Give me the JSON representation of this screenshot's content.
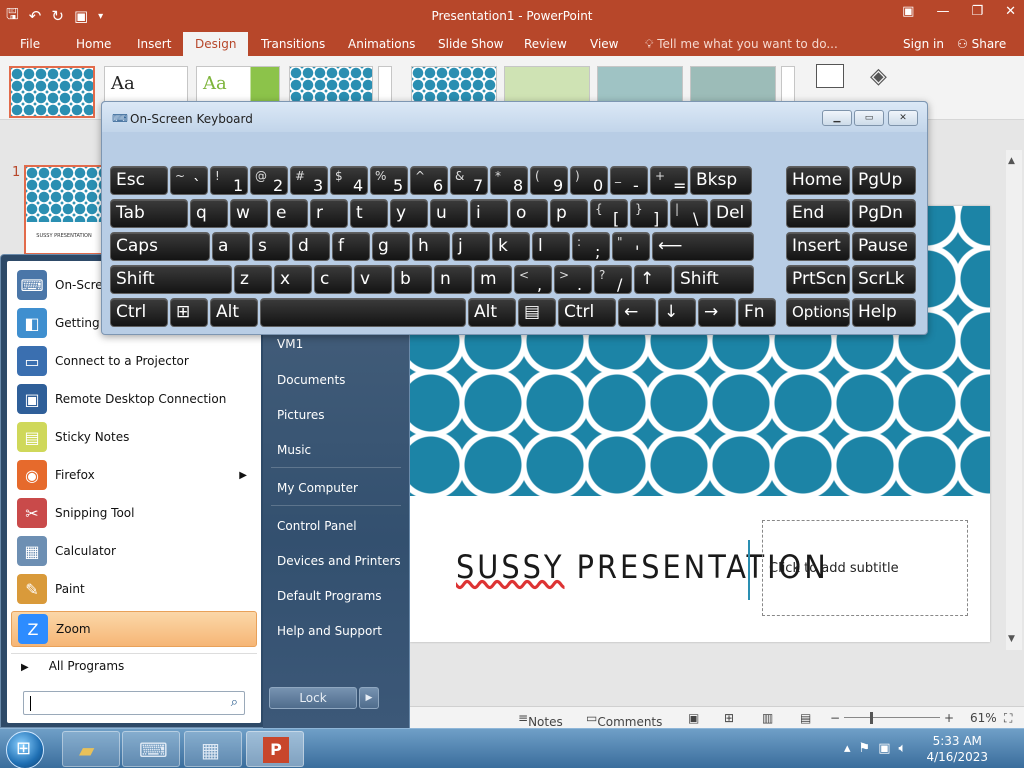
{
  "titlebar": {
    "title": "Presentation1 - PowerPoint",
    "qat_icons": [
      "save-icon",
      "undo-icon",
      "redo-icon",
      "present-icon",
      "customize-icon"
    ]
  },
  "tabs": [
    "File",
    "Home",
    "Insert",
    "Design",
    "Transitions",
    "Animations",
    "Slide Show",
    "Review",
    "View"
  ],
  "active_tab": "Design",
  "tell_me": "Tell me what you want to do...",
  "sign_in": "Sign in",
  "share": "Share",
  "ribbon": {
    "theme_aa": "Aa"
  },
  "thumbnail": {
    "number": "1",
    "caption": "SUSSY PRESENTATION"
  },
  "slide": {
    "title_part1": "SUSSY",
    "title_part2": " PRESENTATION",
    "subtitle_placeholder": "Click to add subtitle"
  },
  "statusbar": {
    "notes": "Notes",
    "comments": "Comments",
    "zoom": "61%",
    "minus": "−",
    "plus": "+"
  },
  "osk": {
    "title": "On-Screen Keyboard",
    "rows": [
      [
        {
          "l": "Esc",
          "w": 58
        },
        {
          "s": "~",
          "m": "`",
          "w": 38
        },
        {
          "s": "!",
          "m": "1",
          "w": 38
        },
        {
          "s": "@",
          "m": "2",
          "w": 38
        },
        {
          "s": "#",
          "m": "3",
          "w": 38
        },
        {
          "s": "$",
          "m": "4",
          "w": 38
        },
        {
          "s": "%",
          "m": "5",
          "w": 38
        },
        {
          "s": "^",
          "m": "6",
          "w": 38
        },
        {
          "s": "&",
          "m": "7",
          "w": 38
        },
        {
          "s": "*",
          "m": "8",
          "w": 38
        },
        {
          "s": "(",
          "m": "9",
          "w": 38
        },
        {
          "s": ")",
          "m": "0",
          "w": 38
        },
        {
          "s": "_",
          "m": "-",
          "w": 38
        },
        {
          "s": "+",
          "m": "=",
          "w": 38
        },
        {
          "l": "Bksp",
          "w": 62
        },
        {
          "l": "Home",
          "w": 64,
          "gap": true
        },
        {
          "l": "PgUp",
          "w": 64
        }
      ],
      [
        {
          "l": "Tab",
          "w": 78
        },
        {
          "l": "q",
          "w": 38
        },
        {
          "l": "w",
          "w": 38
        },
        {
          "l": "e",
          "w": 38
        },
        {
          "l": "r",
          "w": 38
        },
        {
          "l": "t",
          "w": 38
        },
        {
          "l": "y",
          "w": 38
        },
        {
          "l": "u",
          "w": 38
        },
        {
          "l": "i",
          "w": 38
        },
        {
          "l": "o",
          "w": 38
        },
        {
          "l": "p",
          "w": 38
        },
        {
          "s": "{",
          "m": "[",
          "w": 38
        },
        {
          "s": "}",
          "m": "]",
          "w": 38
        },
        {
          "s": "|",
          "m": "\\",
          "w": 38
        },
        {
          "l": "Del",
          "w": 42
        },
        {
          "l": "End",
          "w": 64,
          "gap": true
        },
        {
          "l": "PgDn",
          "w": 64
        }
      ],
      [
        {
          "l": "Caps",
          "w": 100
        },
        {
          "l": "a",
          "w": 38
        },
        {
          "l": "s",
          "w": 38
        },
        {
          "l": "d",
          "w": 38
        },
        {
          "l": "f",
          "w": 38
        },
        {
          "l": "g",
          "w": 38
        },
        {
          "l": "h",
          "w": 38
        },
        {
          "l": "j",
          "w": 38
        },
        {
          "l": "k",
          "w": 38
        },
        {
          "l": "l",
          "w": 38
        },
        {
          "s": ":",
          "m": ";",
          "w": 38
        },
        {
          "s": "\"",
          "m": "'",
          "w": 38
        },
        {
          "l": "⟵",
          "w": 102
        },
        {
          "l": "Insert",
          "w": 64,
          "gap": true
        },
        {
          "l": "Pause",
          "w": 64
        }
      ],
      [
        {
          "l": "Shift",
          "w": 122
        },
        {
          "l": "z",
          "w": 38
        },
        {
          "l": "x",
          "w": 38
        },
        {
          "l": "c",
          "w": 38
        },
        {
          "l": "v",
          "w": 38
        },
        {
          "l": "b",
          "w": 38
        },
        {
          "l": "n",
          "w": 38
        },
        {
          "l": "m",
          "w": 38
        },
        {
          "s": "<",
          "m": ",",
          "w": 38
        },
        {
          "s": ">",
          "m": ".",
          "w": 38
        },
        {
          "s": "?",
          "m": "/",
          "w": 38
        },
        {
          "l": "↑",
          "w": 38
        },
        {
          "l": "Shift",
          "w": 80
        },
        {
          "l": "PrtScn",
          "w": 64,
          "gap": true
        },
        {
          "l": "ScrLk",
          "w": 64
        }
      ],
      [
        {
          "l": "Ctrl",
          "w": 58
        },
        {
          "l": "⊞",
          "w": 38
        },
        {
          "l": "Alt",
          "w": 48
        },
        {
          "l": "",
          "w": 206
        },
        {
          "l": "Alt",
          "w": 48
        },
        {
          "l": "▤",
          "w": 38
        },
        {
          "l": "Ctrl",
          "w": 58
        },
        {
          "l": "←",
          "w": 38
        },
        {
          "l": "↓",
          "w": 38
        },
        {
          "l": "→",
          "w": 38
        },
        {
          "l": "Fn",
          "w": 38
        },
        {
          "l": "Options",
          "w": 64,
          "gap": true,
          "small": true
        },
        {
          "l": "Help",
          "w": 64
        }
      ]
    ]
  },
  "startmenu": {
    "programs": [
      {
        "label": "On-Screen Keyboard",
        "icon": "keyboard-icon",
        "color": "#4a76a8",
        "glyph": "⌨"
      },
      {
        "label": "Getting Started",
        "icon": "getting-started-icon",
        "color": "#3f8fcf",
        "glyph": "◧"
      },
      {
        "label": "Connect to a Projector",
        "icon": "projector-icon",
        "color": "#3a6fb0",
        "glyph": "▭"
      },
      {
        "label": "Remote Desktop Connection",
        "icon": "remote-desktop-icon",
        "color": "#2f5f99",
        "glyph": "▣"
      },
      {
        "label": "Sticky Notes",
        "icon": "sticky-notes-icon",
        "color": "#cfd85a",
        "glyph": "▤"
      },
      {
        "label": "Firefox",
        "icon": "firefox-icon",
        "color": "#e66a2c",
        "glyph": "◉",
        "arrow": true
      },
      {
        "label": "Snipping Tool",
        "icon": "snipping-tool-icon",
        "color": "#c94a4a",
        "glyph": "✂"
      },
      {
        "label": "Calculator",
        "icon": "calculator-icon",
        "color": "#6d8fb3",
        "glyph": "▦"
      },
      {
        "label": "Paint",
        "icon": "paint-icon",
        "color": "#d99a3a",
        "glyph": "✎"
      },
      {
        "label": "Zoom",
        "icon": "zoom-icon",
        "color": "#2d8cff",
        "glyph": "Z",
        "highlight": true
      }
    ],
    "all_programs": "All Programs",
    "right_links": [
      "VM1",
      "Documents",
      "Pictures",
      "Music",
      "My Computer",
      "Control Panel",
      "Devices and Printers",
      "Default Programs",
      "Help and Support"
    ],
    "lock": "Lock"
  },
  "taskbar": {
    "time": "5:33 AM",
    "date": "4/16/2023"
  }
}
